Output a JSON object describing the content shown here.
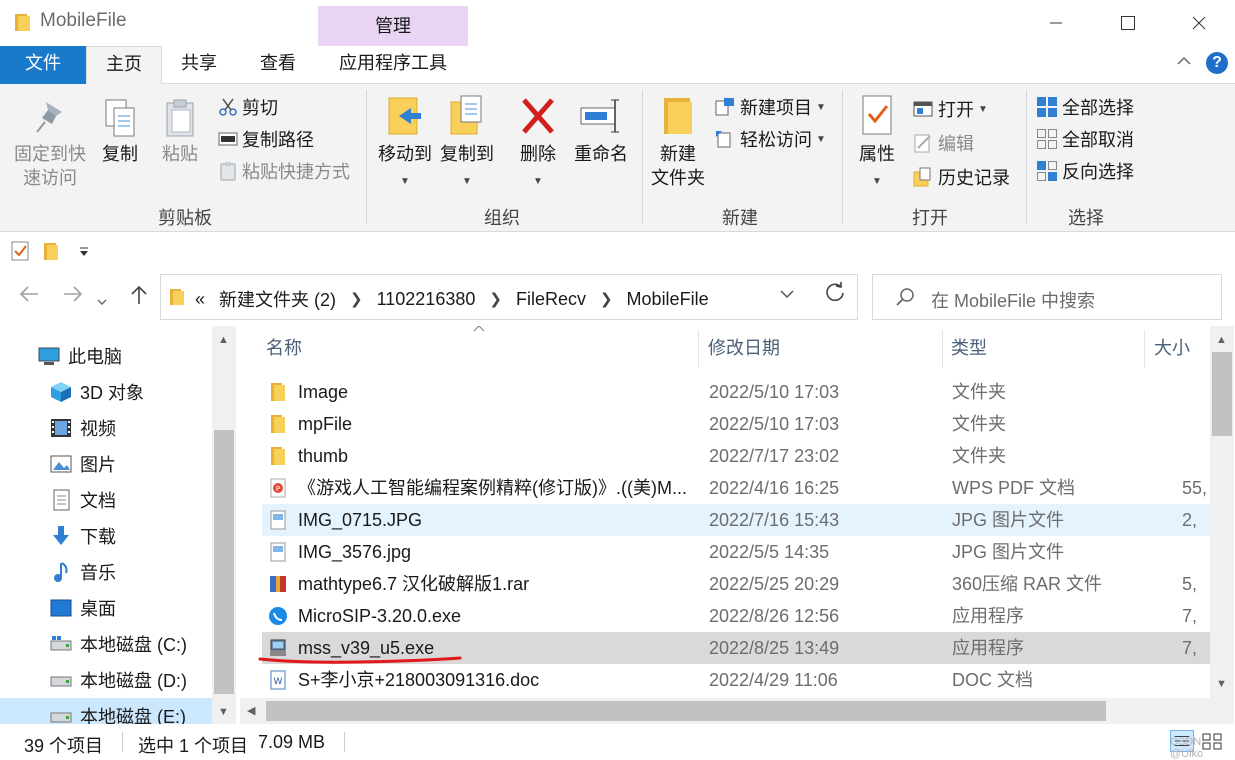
{
  "window": {
    "title": "MobileFile",
    "context_tab": "管理"
  },
  "ribbon_tabs": {
    "file": "文件",
    "home": "主页",
    "share": "共享",
    "view": "查看",
    "app_tools": "应用程序工具"
  },
  "clipboard": {
    "label": "剪贴板",
    "pin_line1": "固定到快",
    "pin_line2": "速访问",
    "copy": "复制",
    "paste": "粘贴",
    "cut": "剪切",
    "copy_path": "复制路径",
    "paste_shortcut": "粘贴快捷方式"
  },
  "organize": {
    "label": "组织",
    "move_to": "移动到",
    "copy_to": "复制到",
    "delete": "删除",
    "rename": "重命名"
  },
  "new_group": {
    "label": "新建",
    "new_folder_line1": "新建",
    "new_folder_line2": "文件夹",
    "new_item": "新建项目",
    "easy_access": "轻松访问"
  },
  "open_group": {
    "label": "打开",
    "properties": "属性",
    "open": "打开",
    "edit": "编辑",
    "history": "历史记录"
  },
  "select_group": {
    "label": "选择",
    "select_all": "全部选择",
    "select_none": "全部取消",
    "invert": "反向选择"
  },
  "address": {
    "overflow": "«",
    "crumbs": [
      "新建文件夹 (2)",
      "1102216380",
      "FileRecv",
      "MobileFile"
    ]
  },
  "search": {
    "placeholder": "在 MobileFile 中搜索"
  },
  "nav": [
    {
      "label": "此电脑",
      "icon": "pc-icon"
    },
    {
      "label": "3D 对象",
      "icon": "3d-objects-icon"
    },
    {
      "label": "视频",
      "icon": "video-icon"
    },
    {
      "label": "图片",
      "icon": "pictures-icon"
    },
    {
      "label": "文档",
      "icon": "documents-icon"
    },
    {
      "label": "下载",
      "icon": "download-icon"
    },
    {
      "label": "音乐",
      "icon": "music-icon"
    },
    {
      "label": "桌面",
      "icon": "desktop-icon"
    },
    {
      "label": "本地磁盘 (C:)",
      "icon": "drive-icon"
    },
    {
      "label": "本地磁盘 (D:)",
      "icon": "drive-icon"
    },
    {
      "label": "本地磁盘 (E:)",
      "icon": "drive-icon"
    }
  ],
  "columns": {
    "name": "名称",
    "date": "修改日期",
    "type": "类型",
    "size": "大小"
  },
  "files": [
    {
      "name": "Image",
      "date": "2022/5/10 17:03",
      "type": "文件夹",
      "size": "",
      "icon": "folder-icon"
    },
    {
      "name": "mpFile",
      "date": "2022/5/10 17:03",
      "type": "文件夹",
      "size": "",
      "icon": "folder-icon"
    },
    {
      "name": "thumb",
      "date": "2022/7/17 23:02",
      "type": "文件夹",
      "size": "",
      "icon": "folder-icon"
    },
    {
      "name": "《游戏人工智能编程案例精粹(修订版)》.((美)M...",
      "date": "2022/4/16 16:25",
      "type": "WPS PDF 文档",
      "size": "55,",
      "icon": "pdf-icon"
    },
    {
      "name": "IMG_0715.JPG",
      "date": "2022/7/16 15:43",
      "type": "JPG 图片文件",
      "size": "2,",
      "icon": "image-icon"
    },
    {
      "name": "IMG_3576.jpg",
      "date": "2022/5/5 14:35",
      "type": "JPG 图片文件",
      "size": "",
      "icon": "image-icon"
    },
    {
      "name": "mathtype6.7 汉化破解版1.rar",
      "date": "2022/5/25 20:29",
      "type": "360压缩 RAR 文件",
      "size": "5,",
      "icon": "archive-icon"
    },
    {
      "name": "MicroSIP-3.20.0.exe",
      "date": "2022/8/26 12:56",
      "type": "应用程序",
      "size": "7,",
      "icon": "microsip-icon"
    },
    {
      "name": "mss_v39_u5.exe",
      "date": "2022/8/25 13:49",
      "type": "应用程序",
      "size": "7,",
      "icon": "installer-icon"
    },
    {
      "name": "S+李小京+218003091316.doc",
      "date": "2022/4/29 11:06",
      "type": "DOC 文档",
      "size": "",
      "icon": "word-doc-icon"
    }
  ],
  "status": {
    "count": "39 个项目",
    "selected": "选中 1 个项目",
    "size": "7.09 MB"
  },
  "watermark": "CSDN @Ulko",
  "colors": {
    "file_tab": "#1979ca",
    "context_tab": "#e9d4f4",
    "selected_row": "#d9d9d9",
    "hover_row": "#e5f3ff",
    "annotation": "#e0191b"
  }
}
